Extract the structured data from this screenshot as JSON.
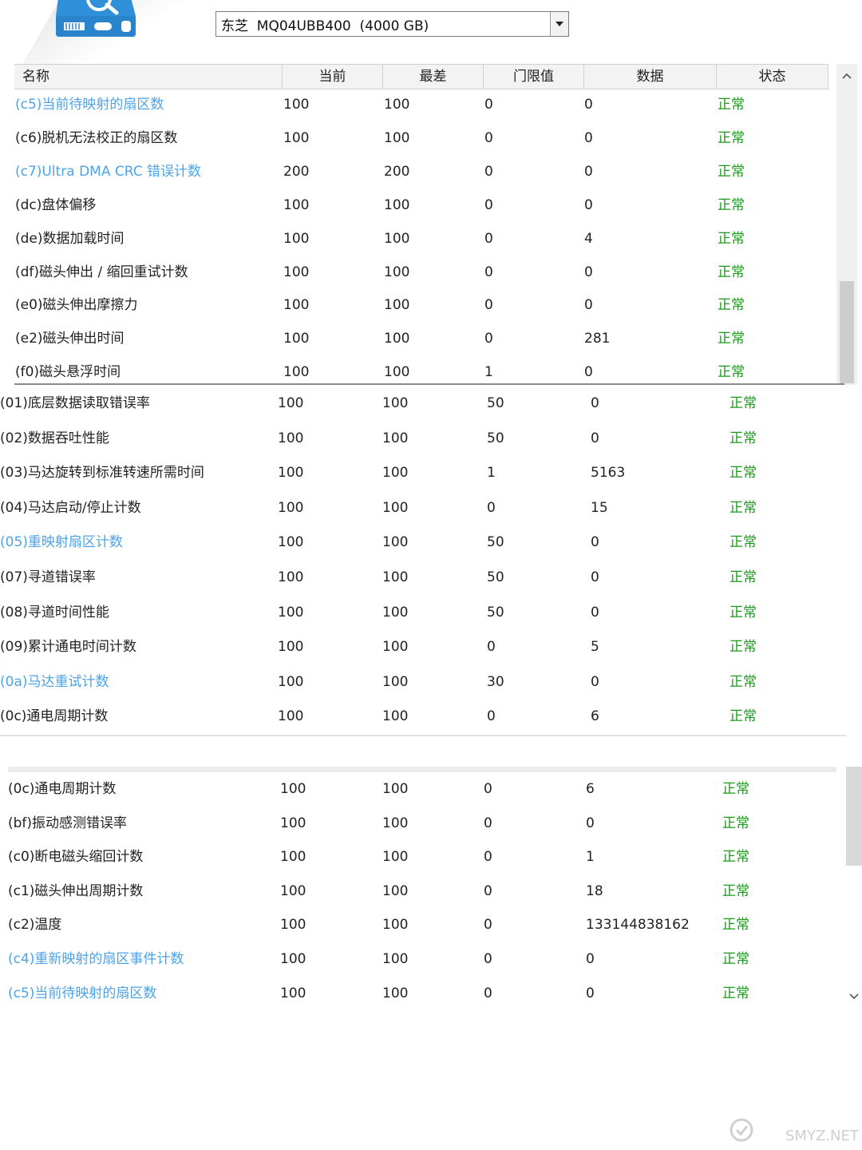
{
  "drive": {
    "selected": "东芝  MQ04UBB400  (4000 GB)"
  },
  "columns": [
    "名称",
    "当前",
    "最差",
    "门限值",
    "数据",
    "状态"
  ],
  "panel1_rows": [
    {
      "name": "(c5)当前待映射的扇区数",
      "current": "100",
      "worst": "100",
      "threshold": "0",
      "data": "0",
      "status": "正常",
      "highlight": true
    },
    {
      "name": "(c6)脱机无法校正的扇区数",
      "current": "100",
      "worst": "100",
      "threshold": "0",
      "data": "0",
      "status": "正常",
      "highlight": false
    },
    {
      "name": "(c7)Ultra DMA CRC 错误计数",
      "current": "200",
      "worst": "200",
      "threshold": "0",
      "data": "0",
      "status": "正常",
      "highlight": true
    },
    {
      "name": "(dc)盘体偏移",
      "current": "100",
      "worst": "100",
      "threshold": "0",
      "data": "0",
      "status": "正常",
      "highlight": false
    },
    {
      "name": "(de)数据加载时间",
      "current": "100",
      "worst": "100",
      "threshold": "0",
      "data": "4",
      "status": "正常",
      "highlight": false
    },
    {
      "name": "(df)磁头伸出 / 缩回重试计数",
      "current": "100",
      "worst": "100",
      "threshold": "0",
      "data": "0",
      "status": "正常",
      "highlight": false
    },
    {
      "name": "(e0)磁头伸出摩擦力",
      "current": "100",
      "worst": "100",
      "threshold": "0",
      "data": "0",
      "status": "正常",
      "highlight": false
    },
    {
      "name": "(e2)磁头伸出时间",
      "current": "100",
      "worst": "100",
      "threshold": "0",
      "data": "281",
      "status": "正常",
      "highlight": false
    },
    {
      "name": "(f0)磁头悬浮时间",
      "current": "100",
      "worst": "100",
      "threshold": "1",
      "data": "0",
      "status": "正常",
      "highlight": false
    }
  ],
  "panel2_rows": [
    {
      "name": "(01)底层数据读取错误率",
      "current": "100",
      "worst": "100",
      "threshold": "50",
      "data": "0",
      "status": "正常",
      "highlight": false
    },
    {
      "name": "(02)数据吞吐性能",
      "current": "100",
      "worst": "100",
      "threshold": "50",
      "data": "0",
      "status": "正常",
      "highlight": false
    },
    {
      "name": "(03)马达旋转到标准转速所需时间",
      "current": "100",
      "worst": "100",
      "threshold": "1",
      "data": "5163",
      "status": "正常",
      "highlight": false
    },
    {
      "name": "(04)马达启动/停止计数",
      "current": "100",
      "worst": "100",
      "threshold": "0",
      "data": "15",
      "status": "正常",
      "highlight": false
    },
    {
      "name": "(05)重映射扇区计数",
      "current": "100",
      "worst": "100",
      "threshold": "50",
      "data": "0",
      "status": "正常",
      "highlight": true
    },
    {
      "name": "(07)寻道错误率",
      "current": "100",
      "worst": "100",
      "threshold": "50",
      "data": "0",
      "status": "正常",
      "highlight": false
    },
    {
      "name": "(08)寻道时间性能",
      "current": "100",
      "worst": "100",
      "threshold": "50",
      "data": "0",
      "status": "正常",
      "highlight": false
    },
    {
      "name": "(09)累计通电时间计数",
      "current": "100",
      "worst": "100",
      "threshold": "0",
      "data": "5",
      "status": "正常",
      "highlight": false
    },
    {
      "name": "(0a)马达重试计数",
      "current": "100",
      "worst": "100",
      "threshold": "30",
      "data": "0",
      "status": "正常",
      "highlight": true
    },
    {
      "name": "(0c)通电周期计数",
      "current": "100",
      "worst": "100",
      "threshold": "0",
      "data": "6",
      "status": "正常",
      "highlight": false
    }
  ],
  "panel3_rows": [
    {
      "name": "(0c)通电周期计数",
      "current": "100",
      "worst": "100",
      "threshold": "0",
      "data": "6",
      "status": "正常",
      "highlight": false
    },
    {
      "name": "(bf)振动感测错误率",
      "current": "100",
      "worst": "100",
      "threshold": "0",
      "data": "0",
      "status": "正常",
      "highlight": false
    },
    {
      "name": "(c0)断电磁头缩回计数",
      "current": "100",
      "worst": "100",
      "threshold": "0",
      "data": "1",
      "status": "正常",
      "highlight": false
    },
    {
      "name": "(c1)磁头伸出周期计数",
      "current": "100",
      "worst": "100",
      "threshold": "0",
      "data": "18",
      "status": "正常",
      "highlight": false
    },
    {
      "name": "(c2)温度",
      "current": "100",
      "worst": "100",
      "threshold": "0",
      "data": "133144838162",
      "status": "正常",
      "highlight": false
    },
    {
      "name": "(c4)重新映射的扇区事件计数",
      "current": "100",
      "worst": "100",
      "threshold": "0",
      "data": "0",
      "status": "正常",
      "highlight": true
    },
    {
      "name": "(c5)当前待映射的扇区数",
      "current": "100",
      "worst": "100",
      "threshold": "0",
      "data": "0",
      "status": "正常",
      "highlight": true
    }
  ],
  "watermark": {
    "text": "SMYZ.NET"
  },
  "colors": {
    "highlight_text": "#4da3e8",
    "status_ok": "#1a9a1a",
    "logo": "#2f8fd8"
  }
}
